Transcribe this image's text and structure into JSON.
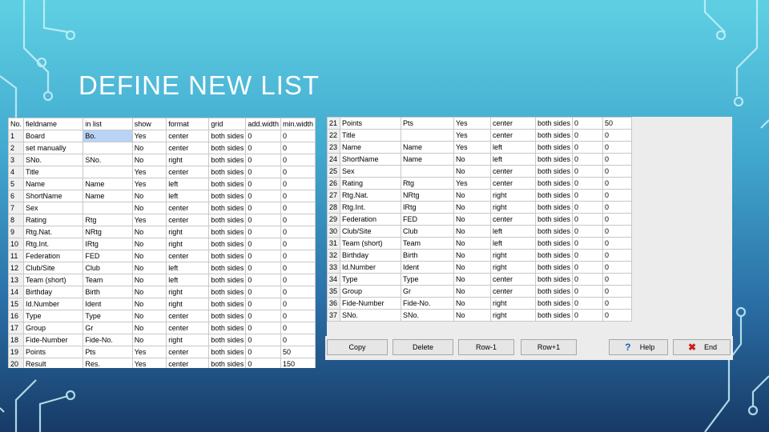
{
  "title": "DEFINE NEW LIST",
  "left_table": {
    "headers": [
      "No.",
      "fieldname",
      "in list",
      "show",
      "format",
      "grid",
      "add.width",
      "min.width"
    ],
    "rows": [
      [
        "1",
        "Board",
        "Bo.",
        "Yes",
        "center",
        "both sides",
        "0",
        "0"
      ],
      [
        "2",
        "set manually",
        "",
        "No",
        "center",
        "both sides",
        "0",
        "0"
      ],
      [
        "3",
        "SNo.",
        "SNo.",
        "No",
        "right",
        "both sides",
        "0",
        "0"
      ],
      [
        "4",
        "Title",
        "",
        "Yes",
        "center",
        "both sides",
        "0",
        "0"
      ],
      [
        "5",
        "Name",
        "Name",
        "Yes",
        "left",
        "both sides",
        "0",
        "0"
      ],
      [
        "6",
        "ShortName",
        "Name",
        "No",
        "left",
        "both sides",
        "0",
        "0"
      ],
      [
        "7",
        "Sex",
        "",
        "No",
        "center",
        "both sides",
        "0",
        "0"
      ],
      [
        "8",
        "Rating",
        "Rtg",
        "Yes",
        "center",
        "both sides",
        "0",
        "0"
      ],
      [
        "9",
        "Rtg.Nat.",
        "NRtg",
        "No",
        "right",
        "both sides",
        "0",
        "0"
      ],
      [
        "10",
        "Rtg.Int.",
        "IRtg",
        "No",
        "right",
        "both sides",
        "0",
        "0"
      ],
      [
        "11",
        "Federation",
        "FED",
        "No",
        "center",
        "both sides",
        "0",
        "0"
      ],
      [
        "12",
        "Club/Site",
        "Club",
        "No",
        "left",
        "both sides",
        "0",
        "0"
      ],
      [
        "13",
        "Team (short)",
        "Team",
        "No",
        "left",
        "both sides",
        "0",
        "0"
      ],
      [
        "14",
        "Birthday",
        "Birth",
        "No",
        "right",
        "both sides",
        "0",
        "0"
      ],
      [
        "15",
        "Id.Number",
        "Ident",
        "No",
        "right",
        "both sides",
        "0",
        "0"
      ],
      [
        "16",
        "Type",
        "Type",
        "No",
        "center",
        "both sides",
        "0",
        "0"
      ],
      [
        "17",
        "Group",
        "Gr",
        "No",
        "center",
        "both sides",
        "0",
        "0"
      ],
      [
        "18",
        "Fide-Number",
        "Fide-No.",
        "No",
        "right",
        "both sides",
        "0",
        "0"
      ],
      [
        "19",
        "Points",
        "Pts",
        "Yes",
        "center",
        "both sides",
        "0",
        "50"
      ],
      [
        "20",
        "Result",
        "Res.",
        "Yes",
        "center",
        "both sides",
        "0",
        "150"
      ]
    ]
  },
  "right_table": {
    "rows": [
      [
        "21",
        "Points",
        "Pts",
        "Yes",
        "center",
        "both sides",
        "0",
        "50"
      ],
      [
        "22",
        "Title",
        "",
        "Yes",
        "center",
        "both sides",
        "0",
        "0"
      ],
      [
        "23",
        "Name",
        "Name",
        "Yes",
        "left",
        "both sides",
        "0",
        "0"
      ],
      [
        "24",
        "ShortName",
        "Name",
        "No",
        "left",
        "both sides",
        "0",
        "0"
      ],
      [
        "25",
        "Sex",
        "",
        "No",
        "center",
        "both sides",
        "0",
        "0"
      ],
      [
        "26",
        "Rating",
        "Rtg",
        "Yes",
        "center",
        "both sides",
        "0",
        "0"
      ],
      [
        "27",
        "Rtg.Nat.",
        "NRtg",
        "No",
        "right",
        "both sides",
        "0",
        "0"
      ],
      [
        "28",
        "Rtg.Int.",
        "IRtg",
        "No",
        "right",
        "both sides",
        "0",
        "0"
      ],
      [
        "29",
        "Federation",
        "FED",
        "No",
        "center",
        "both sides",
        "0",
        "0"
      ],
      [
        "30",
        "Club/Site",
        "Club",
        "No",
        "left",
        "both sides",
        "0",
        "0"
      ],
      [
        "31",
        "Team (short)",
        "Team",
        "No",
        "left",
        "both sides",
        "0",
        "0"
      ],
      [
        "32",
        "Birthday",
        "Birth",
        "No",
        "right",
        "both sides",
        "0",
        "0"
      ],
      [
        "33",
        "Id.Number",
        "Ident",
        "No",
        "right",
        "both sides",
        "0",
        "0"
      ],
      [
        "34",
        "Type",
        "Type",
        "No",
        "center",
        "both sides",
        "0",
        "0"
      ],
      [
        "35",
        "Group",
        "Gr",
        "No",
        "center",
        "both sides",
        "0",
        "0"
      ],
      [
        "36",
        "Fide-Number",
        "Fide-No.",
        "No",
        "right",
        "both sides",
        "0",
        "0"
      ],
      [
        "37",
        "SNo.",
        "SNo.",
        "No",
        "right",
        "both sides",
        "0",
        "0"
      ]
    ]
  },
  "buttons": {
    "copy": "Copy",
    "delete": "Delete",
    "row_up": "Row-1",
    "row_down": "Row+1",
    "help": "Help",
    "end": "End"
  },
  "colors": {
    "accent_selected": "#b8d3f5",
    "help_icon": "#1a5fb4",
    "end_icon": "#cc1e1e"
  }
}
